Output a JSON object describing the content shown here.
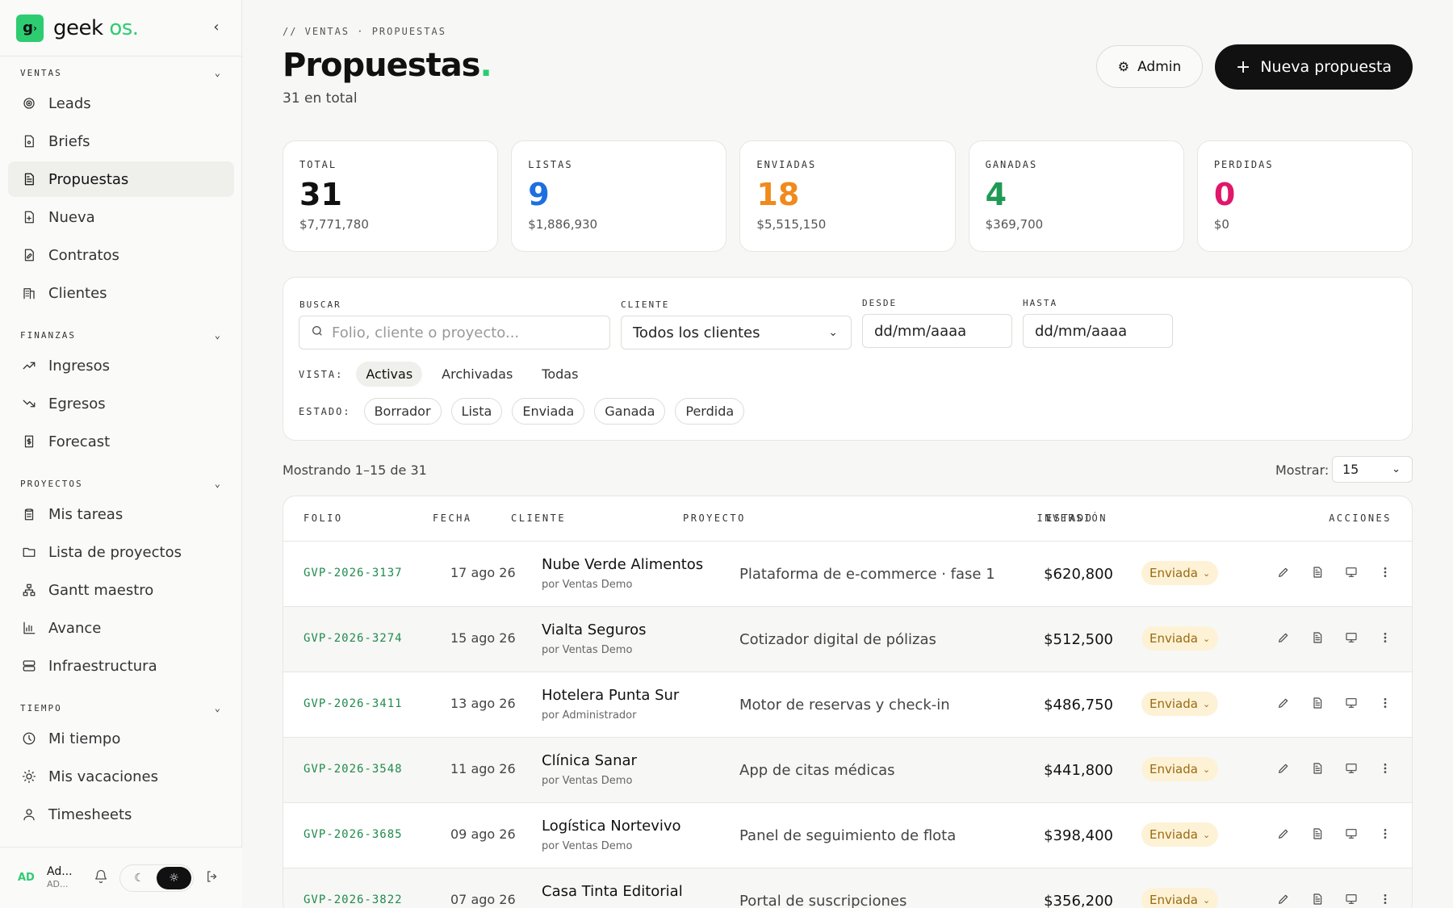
{
  "brand": {
    "name": "geek",
    "suffix": "os",
    "dot": "."
  },
  "sidebar": {
    "sections": [
      {
        "title": "VENTAS",
        "items": [
          {
            "label": "Leads",
            "icon": "target-icon"
          },
          {
            "label": "Briefs",
            "icon": "brief-doc-icon"
          },
          {
            "label": "Propuestas",
            "icon": "document-icon",
            "active": true
          },
          {
            "label": "Nueva",
            "icon": "file-plus-icon"
          },
          {
            "label": "Contratos",
            "icon": "contract-icon"
          },
          {
            "label": "Clientes",
            "icon": "building-icon"
          }
        ]
      },
      {
        "title": "FINANZAS",
        "items": [
          {
            "label": "Ingresos",
            "icon": "trend-up-icon"
          },
          {
            "label": "Egresos",
            "icon": "trend-down-icon"
          },
          {
            "label": "Forecast",
            "icon": "dollar-doc-icon"
          }
        ]
      },
      {
        "title": "PROYECTOS",
        "items": [
          {
            "label": "Mis tareas",
            "icon": "clipboard-icon"
          },
          {
            "label": "Lista de proyectos",
            "icon": "folder-icon"
          },
          {
            "label": "Gantt maestro",
            "icon": "hierarchy-icon"
          },
          {
            "label": "Avance",
            "icon": "bar-chart-icon"
          },
          {
            "label": "Infraestructura",
            "icon": "server-icon"
          }
        ]
      },
      {
        "title": "TIEMPO",
        "items": [
          {
            "label": "Mi tiempo",
            "icon": "clock-icon"
          },
          {
            "label": "Mis vacaciones",
            "icon": "sun-icon"
          },
          {
            "label": "Timesheets",
            "icon": "user-icon"
          }
        ]
      }
    ],
    "user": {
      "initials": "AD",
      "name": "Ad...",
      "sub": "AD..."
    }
  },
  "header": {
    "breadcrumb": "// VENTAS · PROPUESTAS",
    "title": "Propuestas",
    "title_dot": ".",
    "subtitle": "31 en total",
    "admin_label": "Admin",
    "new_label": "Nueva propuesta"
  },
  "kpis": [
    {
      "label": "TOTAL",
      "value": "31",
      "amount": "$7,771,780",
      "color": "#111111"
    },
    {
      "label": "LISTAS",
      "value": "9",
      "amount": "$1,886,930",
      "color": "#1d6fe0"
    },
    {
      "label": "ENVIADAS",
      "value": "18",
      "amount": "$5,515,150",
      "color": "#f08a1c"
    },
    {
      "label": "GANADAS",
      "value": "4",
      "amount": "$369,700",
      "color": "#1f9a55"
    },
    {
      "label": "PERDIDAS",
      "value": "0",
      "amount": "$0",
      "color": "#e0176b"
    }
  ],
  "filters": {
    "search_label": "BUSCAR",
    "search_placeholder": "Folio, cliente o proyecto...",
    "client_label": "CLIENTE",
    "client_value": "Todos los clientes",
    "from_label": "DESDE",
    "from_value": "dd/mm/aaaa",
    "to_label": "HASTA",
    "to_value": "dd/mm/aaaa",
    "view_label": "VISTA:",
    "views": [
      "Activas",
      "Archivadas",
      "Todas"
    ],
    "status_label": "ESTADO:",
    "statuses": [
      "Borrador",
      "Lista",
      "Enviada",
      "Ganada",
      "Perdida"
    ]
  },
  "listing": {
    "showing": "Mostrando 1–15 de 31",
    "show_label": "Mostrar:",
    "show_value": "15"
  },
  "table": {
    "headers": [
      "FOLIO",
      "FECHA",
      "CLIENTE",
      "PROYECTO",
      "INVERSIÓN",
      "ESTADO",
      "ACCIONES"
    ],
    "rows": [
      {
        "folio": "GVP-2026-3137",
        "fecha": "17 ago 26",
        "cliente": "Nube Verde Alimentos",
        "por": "por Ventas Demo",
        "proyecto": "Plataforma de e-commerce · fase 1",
        "inversion": "$620,800",
        "estado": "Enviada"
      },
      {
        "folio": "GVP-2026-3274",
        "fecha": "15 ago 26",
        "cliente": "Vialta Seguros",
        "por": "por Ventas Demo",
        "proyecto": "Cotizador digital de pólizas",
        "inversion": "$512,500",
        "estado": "Enviada"
      },
      {
        "folio": "GVP-2026-3411",
        "fecha": "13 ago 26",
        "cliente": "Hotelera Punta Sur",
        "por": "por Administrador",
        "proyecto": "Motor de reservas y check-in",
        "inversion": "$486,750",
        "estado": "Enviada"
      },
      {
        "folio": "GVP-2026-3548",
        "fecha": "11 ago 26",
        "cliente": "Clínica Sanar",
        "por": "por Ventas Demo",
        "proyecto": "App de citas médicas",
        "inversion": "$441,800",
        "estado": "Enviada"
      },
      {
        "folio": "GVP-2026-3685",
        "fecha": "09 ago 26",
        "cliente": "Logística Nortevivo",
        "por": "por Ventas Demo",
        "proyecto": "Panel de seguimiento de flota",
        "inversion": "$398,400",
        "estado": "Enviada"
      },
      {
        "folio": "GVP-2026-3822",
        "fecha": "07 ago 26",
        "cliente": "Casa Tinta Editorial",
        "por": "",
        "proyecto": "Portal de suscripciones",
        "inversion": "$356,200",
        "estado": "Enviada"
      }
    ]
  }
}
